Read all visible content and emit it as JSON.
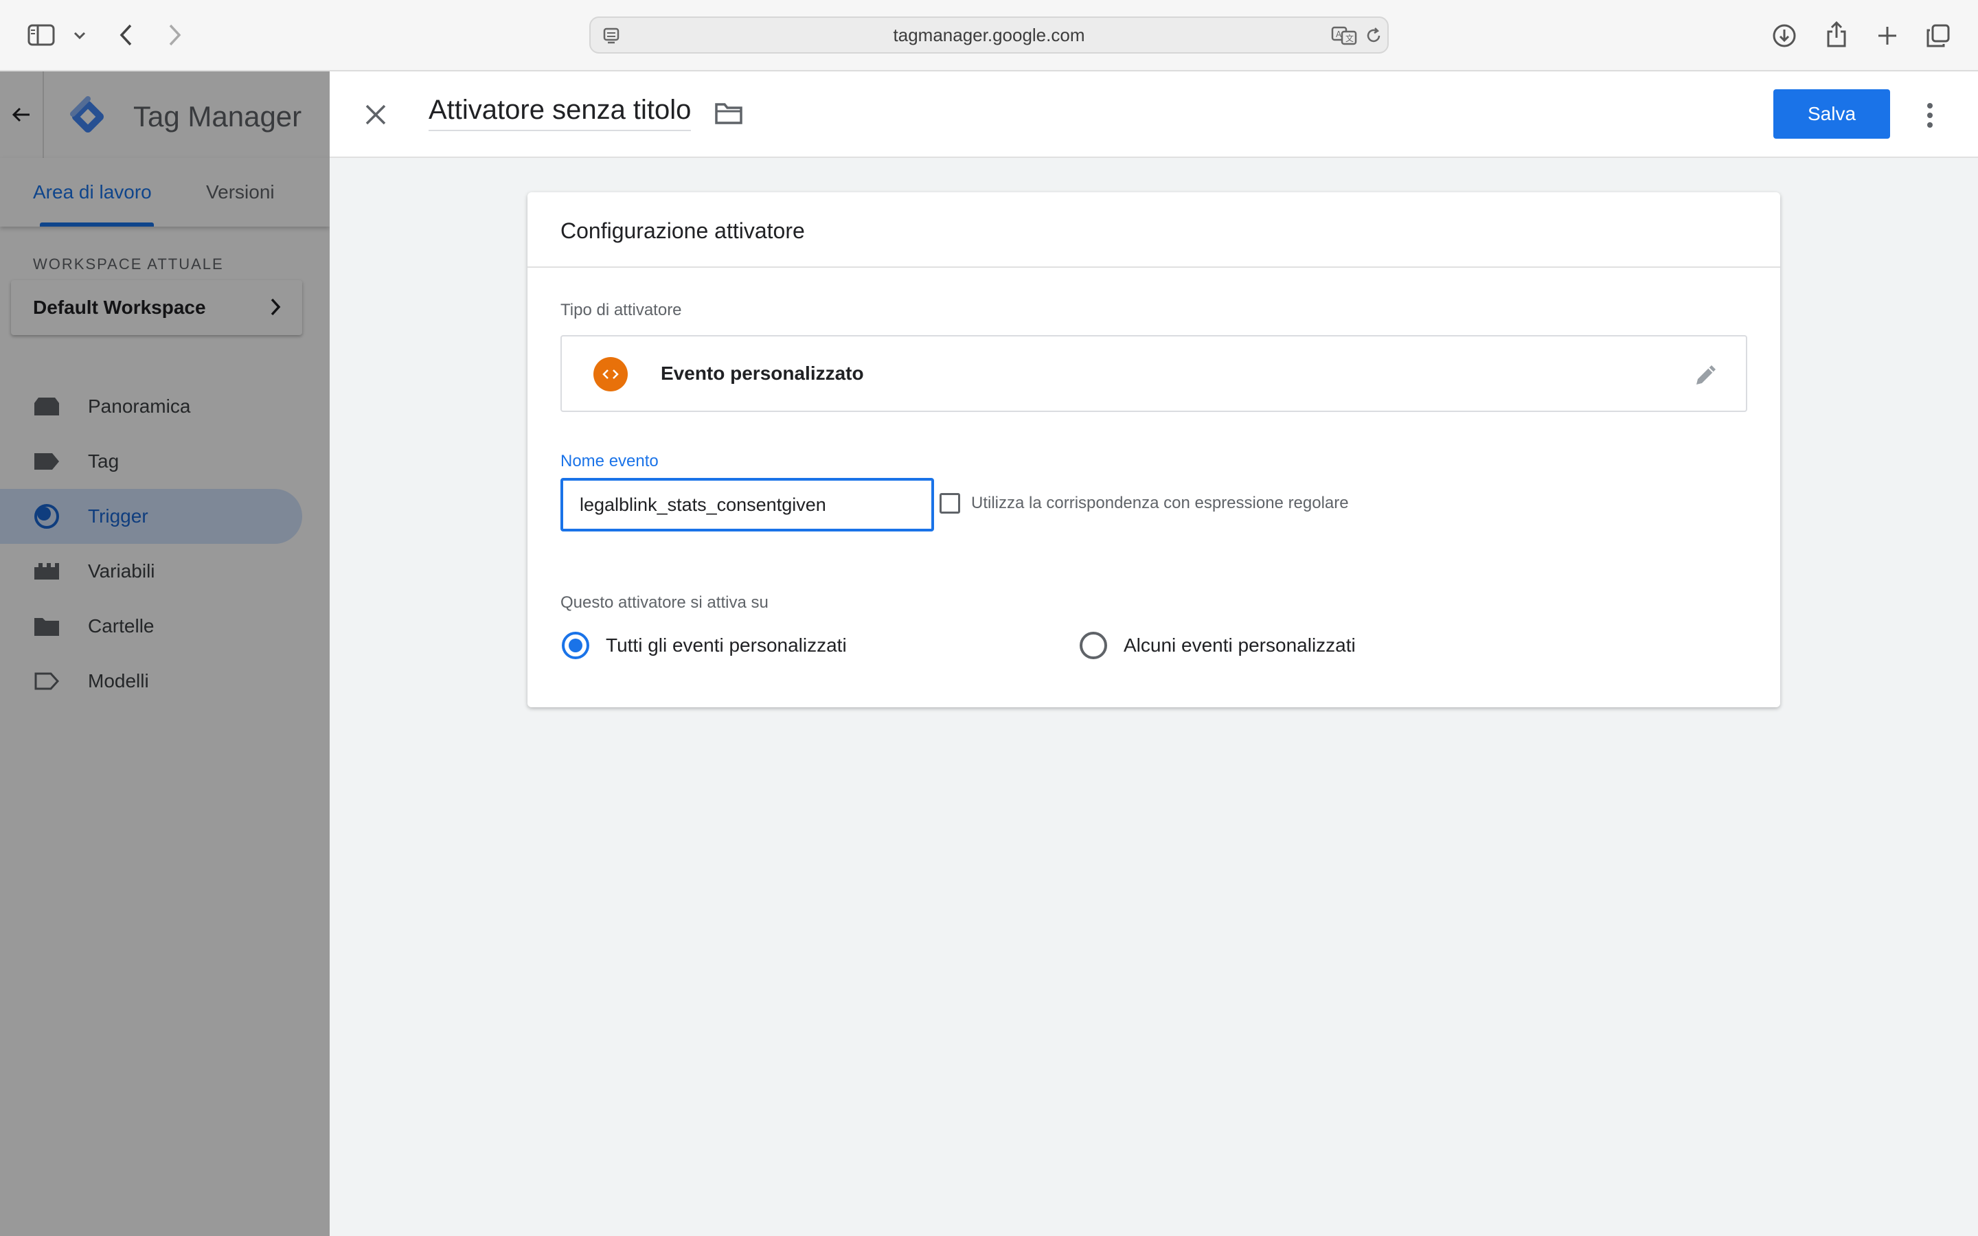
{
  "browser": {
    "url": "tagmanager.google.com"
  },
  "app": {
    "name": "Tag Manager"
  },
  "tabs": {
    "workspace": "Area di lavoro",
    "versions": "Versioni"
  },
  "workspace": {
    "label": "WORKSPACE ATTUALE",
    "current": "Default Workspace"
  },
  "nav": [
    {
      "label": "Panoramica",
      "icon": "overview-icon"
    },
    {
      "label": "Tag",
      "icon": "tag-icon"
    },
    {
      "label": "Trigger",
      "icon": "trigger-icon",
      "active": true
    },
    {
      "label": "Variabili",
      "icon": "variables-icon"
    },
    {
      "label": "Cartelle",
      "icon": "folder-icon"
    },
    {
      "label": "Modelli",
      "icon": "templates-icon"
    }
  ],
  "editor": {
    "title": "Attivatore senza titolo",
    "save_label": "Salva",
    "card_title": "Configurazione attivatore",
    "trigger_type_label": "Tipo di attivatore",
    "trigger_type": "Evento personalizzato",
    "event_name_label": "Nome evento",
    "event_name_value": "legalblink_stats_consentgiven",
    "regex_label": "Utilizza la corrispondenza con espressione regolare",
    "regex_checked": false,
    "fires_on_label": "Questo attivatore si attiva su",
    "fires_on_options": [
      {
        "label": "Tutti gli eventi personalizzati",
        "selected": true
      },
      {
        "label": "Alcuni eventi personalizzati",
        "selected": false
      }
    ]
  },
  "colors": {
    "accent": "#1a73e8",
    "trigger_icon": "#e8710a"
  }
}
